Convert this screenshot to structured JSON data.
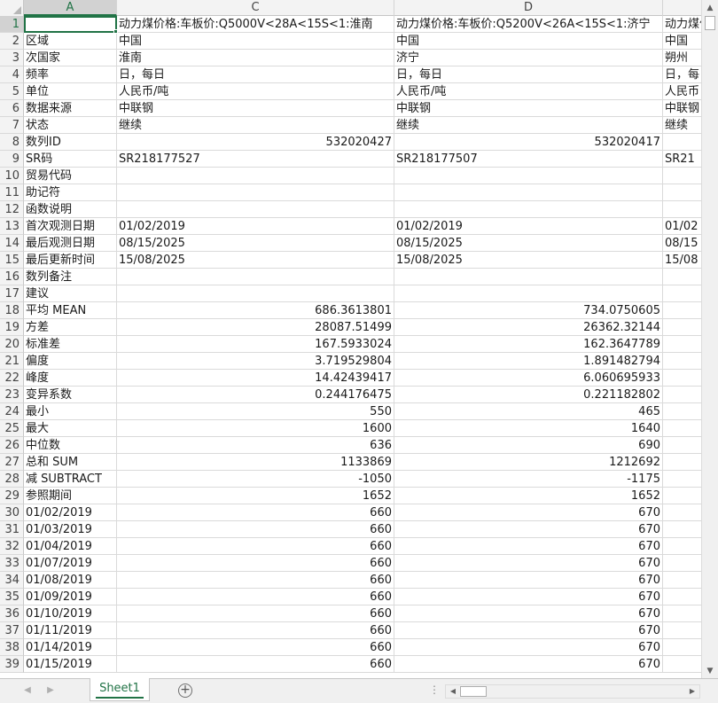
{
  "app": {
    "sheet_tab": "Sheet1",
    "add_sheet_symbol": "+",
    "hscroll_dots": "⋮"
  },
  "columns": [
    "A",
    "C",
    "D",
    ""
  ],
  "rows": [
    {
      "n": "1",
      "a": "",
      "c": "动力煤价格:车板价:Q5000V<28A<15S<1:淮南",
      "d": "动力煤价格:车板价:Q5200V<26A<15S<1:济宁",
      "e": "动力煤价格",
      "cNum": false,
      "dNum": false
    },
    {
      "n": "2",
      "a": "区域",
      "c": "中国",
      "d": "中国",
      "e": "中国",
      "cNum": false,
      "dNum": false
    },
    {
      "n": "3",
      "a": "次国家",
      "c": "淮南",
      "d": "济宁",
      "e": "朔州",
      "cNum": false,
      "dNum": false
    },
    {
      "n": "4",
      "a": "频率",
      "c": "日，每日",
      "d": "日，每日",
      "e": "日，每",
      "cNum": false,
      "dNum": false
    },
    {
      "n": "5",
      "a": "单位",
      "c": "人民币/吨",
      "d": "人民币/吨",
      "e": "人民币",
      "cNum": false,
      "dNum": false
    },
    {
      "n": "6",
      "a": "数据来源",
      "c": "中联钢",
      "d": "中联钢",
      "e": "中联钢",
      "cNum": false,
      "dNum": false
    },
    {
      "n": "7",
      "a": "状态",
      "c": "继续",
      "d": "继续",
      "e": "继续",
      "cNum": false,
      "dNum": false
    },
    {
      "n": "8",
      "a": "数列ID",
      "c": "532020427",
      "d": "532020417",
      "e": "",
      "cNum": true,
      "dNum": true
    },
    {
      "n": "9",
      "a": "SR码",
      "c": "SR218177527",
      "d": "SR218177507",
      "e": "SR21",
      "cNum": false,
      "dNum": false
    },
    {
      "n": "10",
      "a": "贸易代码",
      "c": "",
      "d": "",
      "e": "",
      "cNum": false,
      "dNum": false
    },
    {
      "n": "11",
      "a": "助记符",
      "c": "",
      "d": "",
      "e": "",
      "cNum": false,
      "dNum": false
    },
    {
      "n": "12",
      "a": "函数说明",
      "c": "",
      "d": "",
      "e": "",
      "cNum": false,
      "dNum": false
    },
    {
      "n": "13",
      "a": "首次观测日期",
      "c": "01/02/2019",
      "d": "01/02/2019",
      "e": "01/02",
      "cNum": false,
      "dNum": false
    },
    {
      "n": "14",
      "a": "最后观测日期",
      "c": "08/15/2025",
      "d": "08/15/2025",
      "e": "08/15",
      "cNum": false,
      "dNum": false
    },
    {
      "n": "15",
      "a": "最后更新时间",
      "c": "15/08/2025",
      "d": "15/08/2025",
      "e": "15/08",
      "cNum": false,
      "dNum": false
    },
    {
      "n": "16",
      "a": "数列备注",
      "c": "",
      "d": "",
      "e": "",
      "cNum": false,
      "dNum": false
    },
    {
      "n": "17",
      "a": "建议",
      "c": "",
      "d": "",
      "e": "",
      "cNum": false,
      "dNum": false
    },
    {
      "n": "18",
      "a": "平均 MEAN",
      "c": "686.3613801",
      "d": "734.0750605",
      "e": "",
      "cNum": true,
      "dNum": true
    },
    {
      "n": "19",
      "a": "方差",
      "c": "28087.51499",
      "d": "26362.32144",
      "e": "",
      "cNum": true,
      "dNum": true
    },
    {
      "n": "20",
      "a": "标准差",
      "c": "167.5933024",
      "d": "162.3647789",
      "e": "",
      "cNum": true,
      "dNum": true
    },
    {
      "n": "21",
      "a": "偏度",
      "c": "3.719529804",
      "d": "1.891482794",
      "e": "",
      "cNum": true,
      "dNum": true
    },
    {
      "n": "22",
      "a": "峰度",
      "c": "14.42439417",
      "d": "6.060695933",
      "e": "",
      "cNum": true,
      "dNum": true
    },
    {
      "n": "23",
      "a": "变异系数",
      "c": "0.244176475",
      "d": "0.221182802",
      "e": "",
      "cNum": true,
      "dNum": true
    },
    {
      "n": "24",
      "a": "最小",
      "c": "550",
      "d": "465",
      "e": "",
      "cNum": true,
      "dNum": true
    },
    {
      "n": "25",
      "a": "最大",
      "c": "1600",
      "d": "1640",
      "e": "",
      "cNum": true,
      "dNum": true
    },
    {
      "n": "26",
      "a": "中位数",
      "c": "636",
      "d": "690",
      "e": "",
      "cNum": true,
      "dNum": true
    },
    {
      "n": "27",
      "a": "总和 SUM",
      "c": "1133869",
      "d": "1212692",
      "e": "",
      "cNum": true,
      "dNum": true
    },
    {
      "n": "28",
      "a": "减 SUBTRACT",
      "c": "-1050",
      "d": "-1175",
      "e": "",
      "cNum": true,
      "dNum": true
    },
    {
      "n": "29",
      "a": "参照期间",
      "c": "1652",
      "d": "1652",
      "e": "",
      "cNum": true,
      "dNum": true
    },
    {
      "n": "30",
      "a": "01/02/2019",
      "c": "660",
      "d": "670",
      "e": "",
      "cNum": true,
      "dNum": true
    },
    {
      "n": "31",
      "a": "01/03/2019",
      "c": "660",
      "d": "670",
      "e": "",
      "cNum": true,
      "dNum": true
    },
    {
      "n": "32",
      "a": "01/04/2019",
      "c": "660",
      "d": "670",
      "e": "",
      "cNum": true,
      "dNum": true
    },
    {
      "n": "33",
      "a": "01/07/2019",
      "c": "660",
      "d": "670",
      "e": "",
      "cNum": true,
      "dNum": true
    },
    {
      "n": "34",
      "a": "01/08/2019",
      "c": "660",
      "d": "670",
      "e": "",
      "cNum": true,
      "dNum": true
    },
    {
      "n": "35",
      "a": "01/09/2019",
      "c": "660",
      "d": "670",
      "e": "",
      "cNum": true,
      "dNum": true
    },
    {
      "n": "36",
      "a": "01/10/2019",
      "c": "660",
      "d": "670",
      "e": "",
      "cNum": true,
      "dNum": true
    },
    {
      "n": "37",
      "a": "01/11/2019",
      "c": "660",
      "d": "670",
      "e": "",
      "cNum": true,
      "dNum": true
    },
    {
      "n": "38",
      "a": "01/14/2019",
      "c": "660",
      "d": "670",
      "e": "",
      "cNum": true,
      "dNum": true
    },
    {
      "n": "39",
      "a": "01/15/2019",
      "c": "660",
      "d": "670",
      "e": "",
      "cNum": true,
      "dNum": true
    }
  ],
  "colors": {
    "accent": "#217346",
    "header_bg": "#f3f3f3",
    "gridline": "#dadada"
  }
}
